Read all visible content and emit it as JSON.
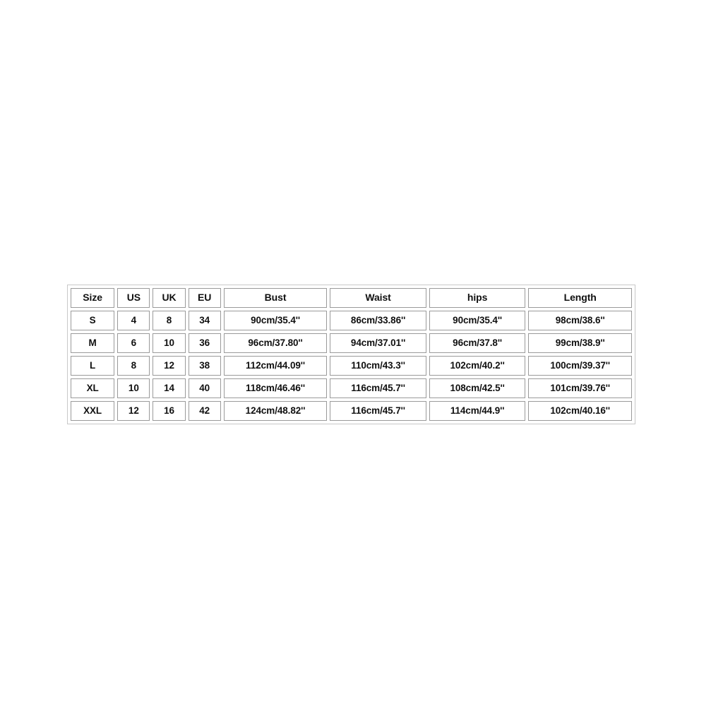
{
  "table": {
    "name": "size-chart",
    "headers": [
      "Size",
      "US",
      "UK",
      "EU",
      "Bust",
      "Waist",
      "hips",
      "Length"
    ],
    "rows": [
      {
        "size": "S",
        "us": "4",
        "uk": "8",
        "eu": "34",
        "bust": "90cm/35.4''",
        "waist": "86cm/33.86''",
        "hips": "90cm/35.4''",
        "length": "98cm/38.6''"
      },
      {
        "size": "M",
        "us": "6",
        "uk": "10",
        "eu": "36",
        "bust": "96cm/37.80''",
        "waist": "94cm/37.01''",
        "hips": "96cm/37.8''",
        "length": "99cm/38.9''"
      },
      {
        "size": "L",
        "us": "8",
        "uk": "12",
        "eu": "38",
        "bust": "112cm/44.09''",
        "waist": "110cm/43.3''",
        "hips": "102cm/40.2''",
        "length": "100cm/39.37''"
      },
      {
        "size": "XL",
        "us": "10",
        "uk": "14",
        "eu": "40",
        "bust": "118cm/46.46''",
        "waist": "116cm/45.7''",
        "hips": "108cm/42.5''",
        "length": "101cm/39.76''"
      },
      {
        "size": "XXL",
        "us": "12",
        "uk": "16",
        "eu": "42",
        "bust": "124cm/48.82''",
        "waist": "116cm/45.7''",
        "hips": "114cm/44.9''",
        "length": "102cm/40.16''"
      }
    ]
  },
  "colors": {
    "background": "#ffffff",
    "text": "#101010",
    "cell_border": "#9a9a9a",
    "outer_border": "#c8c8c8"
  }
}
